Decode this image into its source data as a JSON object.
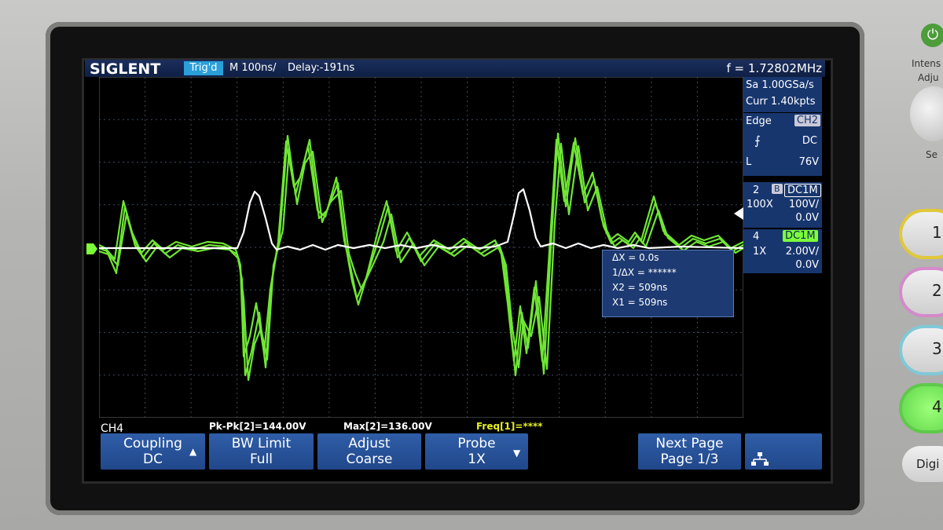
{
  "brand": "SIGLENT",
  "status": {
    "trigger_state": "Trig'd",
    "timebase": "M 100ns/",
    "delay": "Delay:-191ns",
    "frequency": "f = 1.72802MHz"
  },
  "acquisition": {
    "sample_rate": "Sa 1.00GSa/s",
    "memory": "Curr 1.40kpts"
  },
  "trigger": {
    "type": "Edge",
    "source": "CH2",
    "coupling": "DC",
    "level_label": "L",
    "level": "76V"
  },
  "channels": [
    {
      "number": "2",
      "bw_flag": "B",
      "coupling": "DC1M",
      "probe": "100X",
      "scale": "100V/",
      "offset": "0.0V",
      "color": "#ffffff"
    },
    {
      "number": "4",
      "coupling": "DC1M",
      "probe": "1X",
      "scale": "2.00V/",
      "offset": "0.0V",
      "color": "#7cff3a"
    }
  ],
  "cursors": {
    "delta_x": "ΔX = 0.0s",
    "inv_delta_x": "1/ΔX = ******",
    "x2": "X2 = 509ns",
    "x1": "X1 = 509ns"
  },
  "measurements": {
    "channel_label": "CH4",
    "pkpk": "Pk-Pk[2]=144.00V",
    "max": "Max[2]=136.00V",
    "freq": "Freq[1]=****"
  },
  "menu": [
    {
      "line1": "Coupling",
      "line2": "DC",
      "icon": "arrow-up-icon"
    },
    {
      "line1": "BW Limit",
      "line2": "Full",
      "icon": ""
    },
    {
      "line1": "Adjust",
      "line2": "Coarse",
      "icon": ""
    },
    {
      "line1": "Probe",
      "line2": "1X",
      "icon": "arrow-down-icon"
    },
    {
      "line1": "Next Page",
      "line2": "Page 1/3",
      "icon": ""
    },
    {
      "line1": "",
      "line2": "",
      "icon": "network-icon"
    }
  ],
  "side_panel": {
    "label_top": "Intens",
    "label_adj": "Adju",
    "label_sel": "Se",
    "buttons": [
      "1",
      "2",
      "3",
      "4"
    ],
    "digital": "Digi"
  },
  "colors": {
    "ch2_trace": "#ffffff",
    "ch4_trace": "#7cff3a",
    "panel_bg": "#18366e",
    "trigger_badge": "#2a9fd8"
  }
}
